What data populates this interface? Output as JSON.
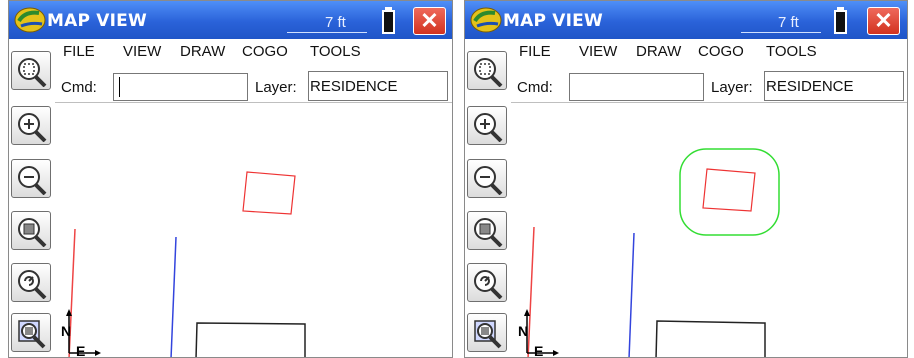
{
  "windows": [
    {
      "title": "MAP VIEW",
      "scale": "7 ft",
      "menu": [
        "FILE",
        "VIEW",
        "DRAW",
        "COGO",
        "TOOLS"
      ],
      "cmd_label": "Cmd:",
      "cmd_value": "",
      "layer_label": "Layer:",
      "layer_value": "RESIDENCE",
      "north_label": "N",
      "east_label": "E",
      "selected_highlight": false
    },
    {
      "title": "MAP VIEW",
      "scale": "7 ft",
      "menu": [
        "FILE",
        "VIEW",
        "DRAW",
        "COGO",
        "TOOLS"
      ],
      "cmd_label": "Cmd:",
      "cmd_value": "",
      "layer_label": "Layer:",
      "layer_value": "RESIDENCE",
      "north_label": "N",
      "east_label": "E",
      "selected_highlight": true
    }
  ],
  "toolbar_icons": [
    "zoom-extents-icon",
    "zoom-in-icon",
    "zoom-out-icon",
    "zoom-window-icon",
    "zoom-previous-icon",
    "pan-icon"
  ],
  "colors": {
    "titlebar": "#2a62d9",
    "close": "#d2321f",
    "polygon": "#ee3333",
    "selection": "#33dd33",
    "blue_line": "#3344dd",
    "red_line": "#ee4444"
  }
}
